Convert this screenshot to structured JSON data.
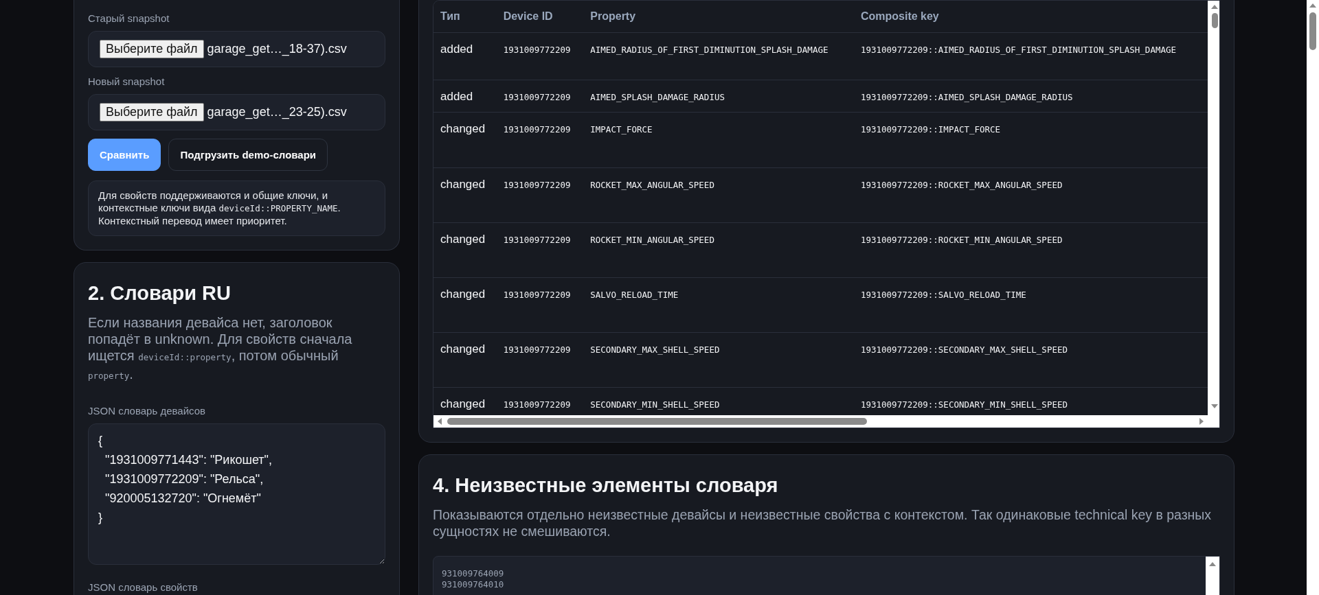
{
  "upload": {
    "fields": [
      {
        "label": "Старый snapshot",
        "button": "Выберите файл",
        "file": "garage_get…_18-37).csv"
      },
      {
        "label": "Новый snapshot",
        "button": "Выберите файл",
        "file": "garage_get…_23-25).csv"
      }
    ],
    "buttons": [
      {
        "kind": "primary",
        "label": "Сравнить"
      },
      {
        "kind": "secondary",
        "label": "Подгрузить demo-словари"
      }
    ],
    "note": [
      {
        "text": "Для свойств поддерживаются и общие ключи, и контекстные ключи вида ",
        "code": false
      },
      {
        "text": "deviceId::PROPERTY_NAME",
        "code": true
      },
      {
        "text": ". Контекстный перевод имеет приоритет.",
        "code": false
      }
    ]
  },
  "dictionaries": {
    "title": "2. Словари RU",
    "description": [
      {
        "text": "Если названия девайса нет, заголовок попадёт в unknown. Для свойств сначала ищется ",
        "code": false
      },
      {
        "text": "deviceId::property",
        "code": true
      },
      {
        "text": ", потом обычный ",
        "code": false
      },
      {
        "text": "property",
        "code": true
      },
      {
        "text": ".",
        "code": false
      }
    ],
    "fields": [
      {
        "label": "JSON словарь девайсов",
        "value": "{\n  \"1931009771443\": \"Рикошет\",\n  \"1931009772209\": \"Рельса\",\n  \"920005132720\": \"Огнемёт\"\n}"
      },
      {
        "label": "JSON словарь свойств"
      }
    ]
  },
  "table": {
    "columns": [
      "Тип",
      "Device ID",
      "Property",
      "Composite key"
    ],
    "rows": [
      [
        "added",
        "1931009772209",
        "AIMED_RADIUS_OF_FIRST_DIMINUTION_SPLASH_DAMAGE",
        "1931009772209::AIMED_RADIUS_OF_FIRST_DIMINUTION_SPLASH_DAMAGE"
      ],
      [
        "added",
        "1931009772209",
        "AIMED_SPLASH_DAMAGE_RADIUS",
        "1931009772209::AIMED_SPLASH_DAMAGE_RADIUS"
      ],
      [
        "changed",
        "1931009772209",
        "IMPACT_FORCE",
        "1931009772209::IMPACT_FORCE"
      ],
      [
        "changed",
        "1931009772209",
        "ROCKET_MAX_ANGULAR_SPEED",
        "1931009772209::ROCKET_MAX_ANGULAR_SPEED"
      ],
      [
        "changed",
        "1931009772209",
        "ROCKET_MIN_ANGULAR_SPEED",
        "1931009772209::ROCKET_MIN_ANGULAR_SPEED"
      ],
      [
        "changed",
        "1931009772209",
        "SALVO_RELOAD_TIME",
        "1931009772209::SALVO_RELOAD_TIME"
      ],
      [
        "changed",
        "1931009772209",
        "SECONDARY_MAX_SHELL_SPEED",
        "1931009772209::SECONDARY_MAX_SHELL_SPEED"
      ],
      [
        "changed",
        "1931009772209",
        "SECONDARY_MIN_SHELL_SPEED",
        "1931009772209::SECONDARY_MIN_SHELL_SPEED"
      ]
    ]
  },
  "unknown": {
    "title": "4. Неизвестные элементы словаря",
    "description": "Показываются отдельно неизвестные девайсы и неизвестные свойства с контекстом. Так одинаковые technical key в разных сущностях не смешиваются.",
    "lines": [
      "931009764009",
      "931009764010"
    ]
  }
}
